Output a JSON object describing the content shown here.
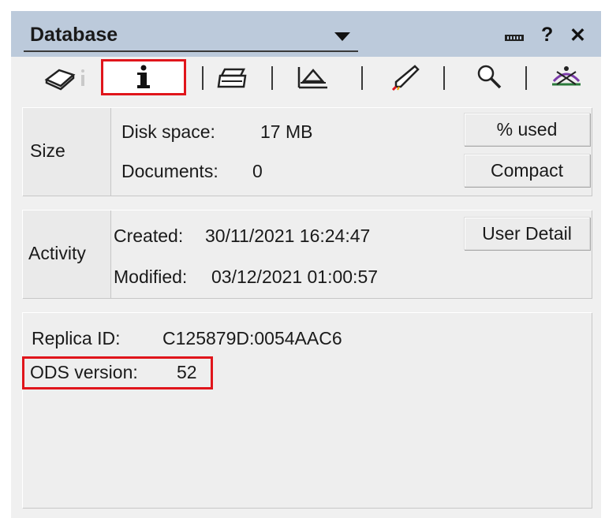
{
  "header": {
    "title": "Database"
  },
  "tabs": [
    {
      "icon": "basics-icon"
    },
    {
      "icon": "info-icon",
      "active": true
    },
    {
      "icon": "printer-icon"
    },
    {
      "icon": "design-icon"
    },
    {
      "icon": "launch-icon"
    },
    {
      "icon": "search-icon"
    },
    {
      "icon": "advanced-icon"
    }
  ],
  "size": {
    "label": "Size",
    "disk_space_label": "Disk space:",
    "disk_space_value": "17 MB",
    "documents_label": "Documents:",
    "documents_value": "0",
    "used_button": "% used",
    "compact_button": "Compact"
  },
  "activity": {
    "label": "Activity",
    "created_label": "Created:",
    "created_value": "30/11/2021 16:24:47",
    "modified_label": "Modified:",
    "modified_value": "03/12/2021 01:00:57",
    "user_detail_button": "User Detail"
  },
  "info": {
    "replica_label": "Replica ID:",
    "replica_value": "C125879D:0054AAC6",
    "ods_label": "ODS version:",
    "ods_value": "52"
  },
  "colors": {
    "titlebar": "#bccadb",
    "highlight": "#e0151b",
    "panel": "#f0f0f0"
  }
}
